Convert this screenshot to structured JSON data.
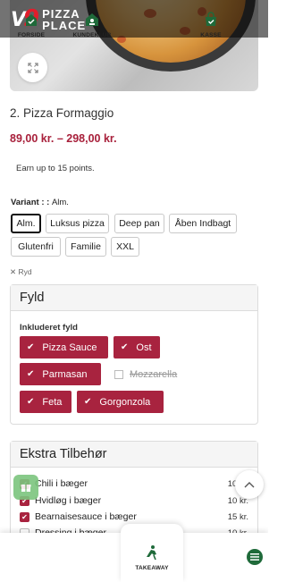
{
  "header": {
    "logo_mark": "V",
    "logo_num": "9",
    "logo_line1": "PIZZA",
    "logo_line2": "PLACE"
  },
  "product": {
    "title": "2. Pizza Formaggio",
    "price_range": "89,00 kr. – 298,00 kr.",
    "points_text": "Earn up to 15 points."
  },
  "variant": {
    "label": "Variant : :",
    "selected": "Alm.",
    "options": [
      "Alm.",
      "Luksus pizza",
      "Deep pan",
      "Åben Indbagt",
      "Glutenfri",
      "Familie",
      "XXL"
    ]
  },
  "clear_label": "✕ Ryd",
  "fyld": {
    "heading": "Fyld",
    "subheading": "Inkluderet fyld",
    "items": [
      {
        "label": "Pizza Sauce",
        "checked": true
      },
      {
        "label": "Ost",
        "checked": true
      },
      {
        "label": "Parmasan",
        "checked": true
      },
      {
        "label": "Mozzarella",
        "checked": false
      },
      {
        "label": "Feta",
        "checked": true
      },
      {
        "label": "Gorgonzola",
        "checked": true
      }
    ]
  },
  "extras": {
    "heading": "Ekstra Tilbehør",
    "items": [
      {
        "label": "Chili i bæger",
        "price": "10 kr.",
        "checked": true
      },
      {
        "label": "Hvidløg i bæger",
        "price": "10 kr.",
        "checked": true
      },
      {
        "label": "Bearnaisesauce i bæger",
        "price": "15 kr.",
        "checked": true
      },
      {
        "label": "Dressing i bæger",
        "price": "10 kr.",
        "checked": false
      }
    ]
  },
  "bottom_nav": [
    {
      "label": "FORSIDE",
      "icon": "home-check-icon"
    },
    {
      "label": "KUNDEKLUB",
      "icon": "club-icon"
    },
    {
      "label": "TAKEAWAY",
      "icon": "takeaway-icon"
    },
    {
      "label": "KASSE",
      "icon": "bag-check-icon"
    }
  ],
  "colors": {
    "accent": "#a8233f",
    "nav_green": "#1f6a3a",
    "fab_green": "#7cc57e"
  }
}
